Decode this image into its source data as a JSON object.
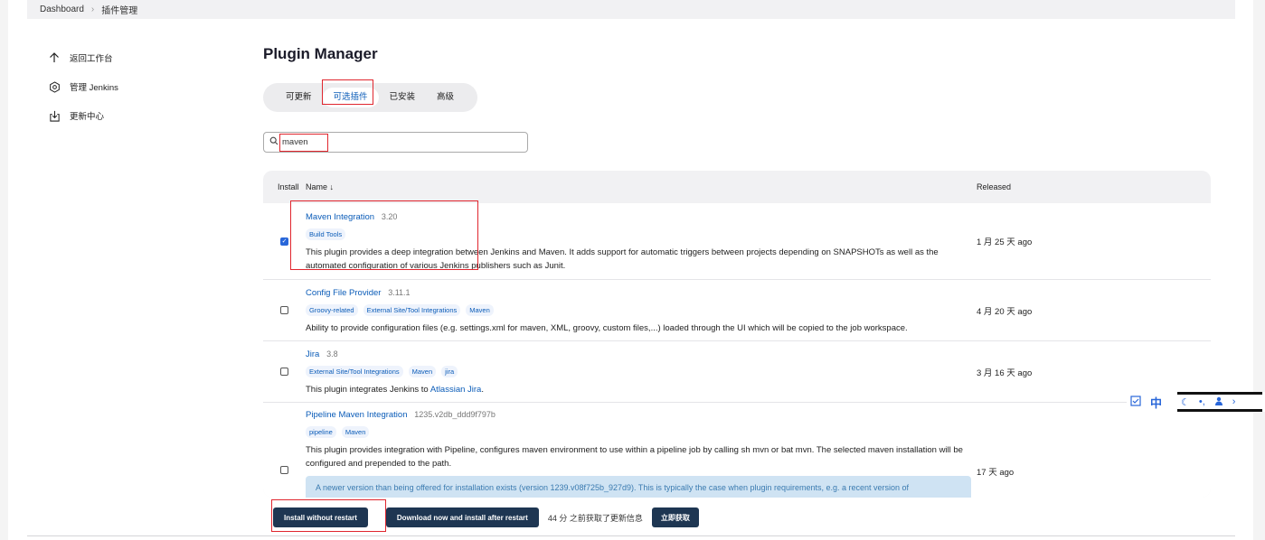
{
  "breadcrumb": [
    "Dashboard",
    "插件管理"
  ],
  "sidebar": {
    "items": [
      {
        "label": "返回工作台",
        "icon": "arrow-up-icon"
      },
      {
        "label": "管理 Jenkins",
        "icon": "gear-icon"
      },
      {
        "label": "更新中心",
        "icon": "download-icon"
      }
    ]
  },
  "page": {
    "title": "Plugin Manager"
  },
  "tabs": [
    {
      "label": "可更新"
    },
    {
      "label": "可选插件"
    },
    {
      "label": "已安装"
    },
    {
      "label": "高级"
    }
  ],
  "active_tab": 1,
  "search": {
    "value": "maven"
  },
  "table": {
    "headers": {
      "install": "Install",
      "name": "Name ↓",
      "released": "Released"
    },
    "rows": [
      {
        "name": "Maven Integration",
        "version": "3.20",
        "checked": true,
        "tags": [
          "Build Tools"
        ],
        "description": "This plugin provides a deep integration between Jenkins and Maven. It adds support for automatic triggers between projects depending on SNAPSHOTs as well as the automated configuration of various Jenkins publishers such as Junit.",
        "released": "1 月 25 天 ago"
      },
      {
        "name": "Config File Provider",
        "version": "3.11.1",
        "checked": false,
        "tags": [
          "Groovy-related",
          "External Site/Tool Integrations",
          "Maven"
        ],
        "description": "Ability to provide configuration files (e.g. settings.xml for maven, XML, groovy, custom files,...) loaded through the UI which will be copied to the job workspace.",
        "released": "4 月 20 天 ago"
      },
      {
        "name": "Jira",
        "version": "3.8",
        "checked": false,
        "tags": [
          "External Site/Tool Integrations",
          "Maven",
          "jira"
        ],
        "description_prefix": "This plugin integrates Jenkins to ",
        "description_link": "Atlassian Jira",
        "description_suffix": ".",
        "released": "3 月 16 天 ago"
      },
      {
        "name": "Pipeline Maven Integration",
        "version": "1235.v2db_ddd9f797b",
        "checked": false,
        "tags": [
          "pipeline",
          "Maven"
        ],
        "description": "This plugin provides integration with Pipeline, configures maven environment to use within a pipeline job by calling sh mvn or bat mvn. The selected maven installation will be configured and prepended to the path.",
        "notice": "A newer version than being offered for installation exists (version 1239.v08f725b_927d9). This is typically the case when plugin requirements, e.g. a recent version of",
        "released": "17 天 ago"
      }
    ]
  },
  "footer": {
    "install_label": "Install without restart",
    "download_label": "Download now and install after restart",
    "update_info": "44 分 之前获取了更新信息",
    "fetch_label": "立即获取"
  },
  "ime": {
    "mode": "中"
  },
  "colors": {
    "link": "#0b5cb8",
    "primary_button": "#1e3652",
    "highlight_box": "#e0262e",
    "tag_bg": "#eef3fc"
  }
}
